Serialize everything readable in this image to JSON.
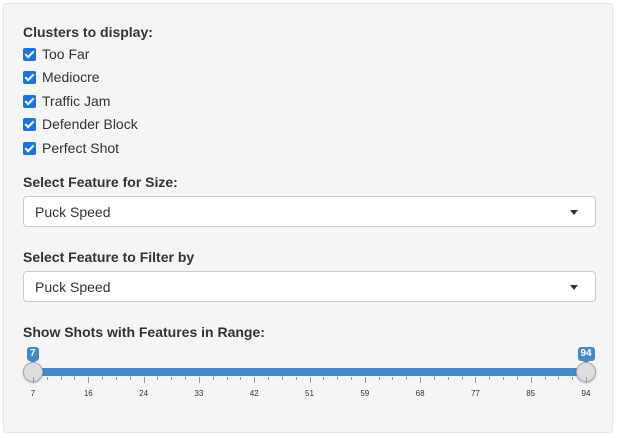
{
  "clusters": {
    "title": "Clusters to display:",
    "items": [
      {
        "label": "Too Far",
        "checked": true
      },
      {
        "label": "Mediocre",
        "checked": true
      },
      {
        "label": "Traffic Jam",
        "checked": true
      },
      {
        "label": "Defender Block",
        "checked": true
      },
      {
        "label": "Perfect Shot",
        "checked": true
      }
    ]
  },
  "size_feature": {
    "label": "Select Feature for Size:",
    "value": "Puck Speed"
  },
  "filter_feature": {
    "label": "Select Feature to Filter by",
    "value": "Puck Speed"
  },
  "range": {
    "label": "Show Shots with Features in Range:",
    "min": 7,
    "max": 94,
    "from": 7,
    "to": 94,
    "from_label": "7",
    "to_label": "94",
    "ticks": [
      "7",
      "16",
      "24",
      "33",
      "42",
      "51",
      "59",
      "68",
      "77",
      "85",
      "94"
    ],
    "accent_color": "#428bca"
  }
}
